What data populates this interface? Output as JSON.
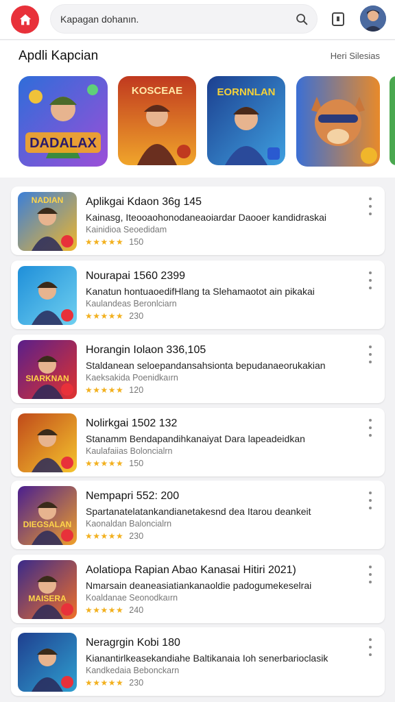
{
  "search": {
    "placeholder": "Kapagan dohanın."
  },
  "featured": {
    "title": "Apdli Kapcian",
    "see_all": "Heri Silesias",
    "tiles": [
      {
        "label_top": "",
        "label_big": "DADALAX",
        "colors": [
          "#2f6dd9",
          "#9b4fd8"
        ]
      },
      {
        "label_top": "KOSCEAE",
        "label_big": "",
        "colors": [
          "#c0391f",
          "#f0a52b"
        ]
      },
      {
        "label_top": "EORNNLAN",
        "label_big": "",
        "colors": [
          "#1c3f8f",
          "#3fa0e0"
        ]
      },
      {
        "label_top": "",
        "label_big": "",
        "colors": [
          "#3b6fd4",
          "#e88a2a"
        ]
      }
    ]
  },
  "apps": [
    {
      "name": "Aplikgai Kdaon 36g 145",
      "desc": "Kainasg, Iteooaohonodaneaoiardar Daooer kandidraskai",
      "dev": "Kainidioa Seoedidam",
      "stars": "★★★★★",
      "count": "150",
      "thumb_text": "NADIAN",
      "colors": [
        "#3b7fd8",
        "#f0b62b"
      ]
    },
    {
      "name": "Nourapai 1560 2399",
      "desc": "Kanatun hontuaoedifHlang ta Slehamaotot ain pikakai",
      "dev": "Kaulandeas Beronlciarn",
      "stars": "★★★★★",
      "count": "230",
      "thumb_text": "",
      "colors": [
        "#1f8fd9",
        "#6fd0f0"
      ]
    },
    {
      "name": "Horangin Iolaon 336,105",
      "desc": "Staldanean seloepandansahsionta bepudanaeorukakian",
      "dev": "Kaeksakida Poenidkaırn",
      "stars": "★★★★★",
      "count": "120",
      "thumb_text": "SIARKNAN",
      "colors": [
        "#5a1f8a",
        "#e0332f"
      ]
    },
    {
      "name": "Nolirkgai 1502 132",
      "desc": "Stanamm Bendapandihkanaiyat Dara lapeadeidkan",
      "dev": "Kaulafaiias Boloncialrn",
      "stars": "★★★★★",
      "count": "150",
      "thumb_text": "",
      "colors": [
        "#c04a1a",
        "#f5c52e"
      ]
    },
    {
      "name": "Nempapri 552: 200",
      "desc": "Spartanatelatankandianetakesnd dea Itarou deankeit",
      "dev": "Kaonaldan Baloncialrn",
      "stars": "★★★★★",
      "count": "230",
      "thumb_text": "DIEGSALAN",
      "colors": [
        "#4a1f8f",
        "#f0a02a"
      ]
    },
    {
      "name": "Aolatiopa Rapian Abao Kanasai Hitiri 2021)",
      "desc": "Nmarsain deaneasiatiankanaoldie padogumekeselrai",
      "dev": "Koaldanae Seonodkaırn",
      "stars": "★★★★★",
      "count": "240",
      "thumb_text": "MAISERA",
      "colors": [
        "#3a2a8a",
        "#f0702a"
      ]
    },
    {
      "name": "Neragrgin Kobi 180",
      "desc": "Kianantirlkeasekandiahe Baltikanaia Ioh senerbarioclasik",
      "dev": "Kandkedaia Bebonckarn",
      "stars": "★★★★★",
      "count": "230",
      "thumb_text": "",
      "colors": [
        "#1f3f8f",
        "#2fa0d0"
      ]
    }
  ],
  "accent": "#e8313a",
  "star_color": "#f2b01e"
}
